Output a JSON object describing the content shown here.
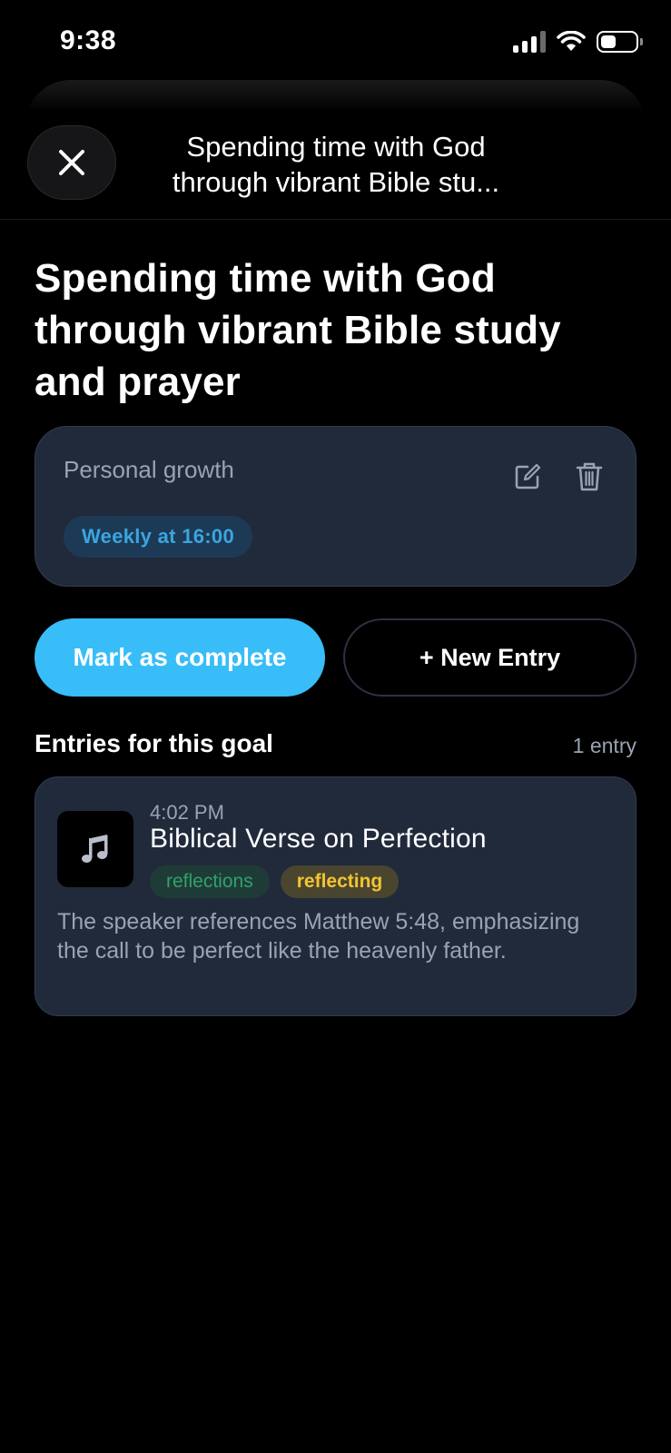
{
  "status_bar": {
    "time": "9:38"
  },
  "header": {
    "close_icon": "close-icon",
    "title": "Spending time with God through vibrant Bible stu..."
  },
  "page": {
    "title": "Spending time with God through vibrant Bible study and prayer"
  },
  "goal": {
    "category": "Personal growth",
    "schedule": "Weekly at 16:00",
    "edit_icon": "edit-icon",
    "delete_icon": "trash-icon"
  },
  "actions": {
    "complete_label": "Mark as complete",
    "new_entry_label": "+ New Entry"
  },
  "entries": {
    "heading": "Entries for this goal",
    "count": "1 entry",
    "items": [
      {
        "time": "4:02 PM",
        "title": "Biblical Verse on Perfection",
        "icon": "music-note-icon",
        "tags": [
          "reflections",
          "reflecting"
        ],
        "description": "The speaker references Matthew 5:48, emphasizing the call to be perfect like the heavenly father."
      }
    ]
  },
  "colors": {
    "accent": "#38bdf8",
    "card_bg": "#212a3b",
    "schedule_text": "#3aa5e0",
    "tag_green": "#2fa36b",
    "tag_yellow": "#f2c531"
  }
}
